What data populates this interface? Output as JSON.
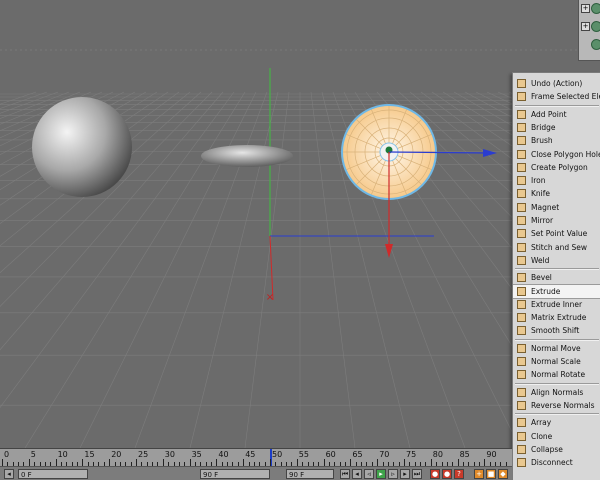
{
  "viewport": {
    "label": "3D viewport",
    "objects": [
      "sphere",
      "disc",
      "selected-sphere"
    ]
  },
  "object_manager": {
    "rows": [
      {
        "expand": "+"
      },
      {
        "expand": "+"
      },
      {
        "expand": ""
      }
    ]
  },
  "context_menu": {
    "groups": [
      [
        {
          "label": "Undo (Action)",
          "icon": "undo-icon"
        },
        {
          "label": "Frame Selected Elements",
          "icon": "frame-selected-icon"
        }
      ],
      [
        {
          "label": "Add Point",
          "icon": "add-point-icon"
        },
        {
          "label": "Bridge",
          "icon": "bridge-icon"
        },
        {
          "label": "Brush",
          "icon": "brush-icon"
        },
        {
          "label": "Close Polygon Hole",
          "icon": "close-polygon-hole-icon"
        },
        {
          "label": "Create Polygon",
          "icon": "create-polygon-icon"
        },
        {
          "label": "Iron",
          "icon": "iron-icon"
        },
        {
          "label": "Knife",
          "icon": "knife-icon"
        },
        {
          "label": "Magnet",
          "icon": "magnet-icon"
        },
        {
          "label": "Mirror",
          "icon": "mirror-icon"
        },
        {
          "label": "Set Point Value",
          "icon": "set-point-value-icon"
        },
        {
          "label": "Stitch and Sew",
          "icon": "stitch-and-sew-icon"
        },
        {
          "label": "Weld",
          "icon": "weld-icon"
        }
      ],
      [
        {
          "label": "Bevel",
          "icon": "bevel-icon"
        },
        {
          "label": "Extrude",
          "icon": "extrude-icon",
          "selected": true
        },
        {
          "label": "Extrude Inner",
          "icon": "extrude-inner-icon"
        },
        {
          "label": "Matrix Extrude",
          "icon": "matrix-extrude-icon"
        },
        {
          "label": "Smooth Shift",
          "icon": "smooth-shift-icon"
        }
      ],
      [
        {
          "label": "Normal Move",
          "icon": "normal-move-icon"
        },
        {
          "label": "Normal Scale",
          "icon": "normal-scale-icon"
        },
        {
          "label": "Normal Rotate",
          "icon": "normal-rotate-icon"
        }
      ],
      [
        {
          "label": "Align Normals",
          "icon": "align-normals-icon"
        },
        {
          "label": "Reverse Normals",
          "icon": "reverse-normals-icon"
        }
      ],
      [
        {
          "label": "Array",
          "icon": "array-icon"
        },
        {
          "label": "Clone",
          "icon": "clone-icon"
        },
        {
          "label": "Collapse",
          "icon": "collapse-icon"
        },
        {
          "label": "Disconnect",
          "icon": "disconnect-icon"
        }
      ]
    ]
  },
  "timeline": {
    "ruler_labels": [
      "0",
      "5",
      "10",
      "15",
      "20",
      "25",
      "30",
      "35",
      "40",
      "45",
      "50",
      "55",
      "60",
      "65",
      "70",
      "75",
      "80",
      "85",
      "90"
    ],
    "current_frame": 50,
    "start_field": "0 F",
    "end_field": "90 F",
    "max_field": "90 F",
    "playhead_color": "#1a3cc8"
  }
}
